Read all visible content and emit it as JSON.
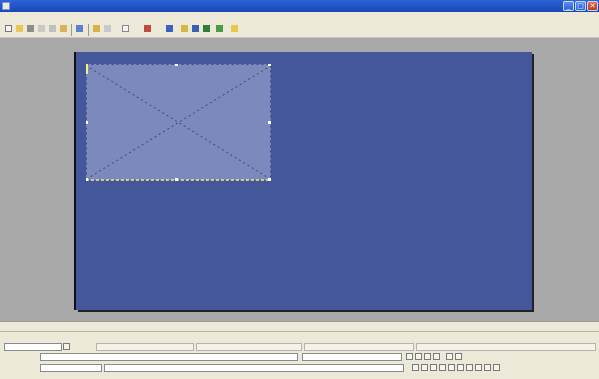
{
  "window": {
    "title": "",
    "controls": {
      "minimize": "_",
      "maximize": "□",
      "close": "✕"
    }
  },
  "menubar": {
    "items": [
      "",
      "",
      "",
      "",
      ""
    ],
    "right_text": ""
  },
  "toolbar": {
    "icons": [
      "new-icon",
      "open-icon",
      "save-icon",
      "cut-icon",
      "pointer-tool-icon",
      "text-tool-icon",
      "layout-icon",
      "insert-image-icon",
      "chart-icon",
      "table-icon",
      "movie-icon",
      "sound-icon"
    ],
    "label": "",
    "info": ""
  },
  "stage": {
    "background_color": "#43579a",
    "placeholder_color": "#7c89bc"
  },
  "panel": {
    "title": "",
    "tab": ""
  }
}
